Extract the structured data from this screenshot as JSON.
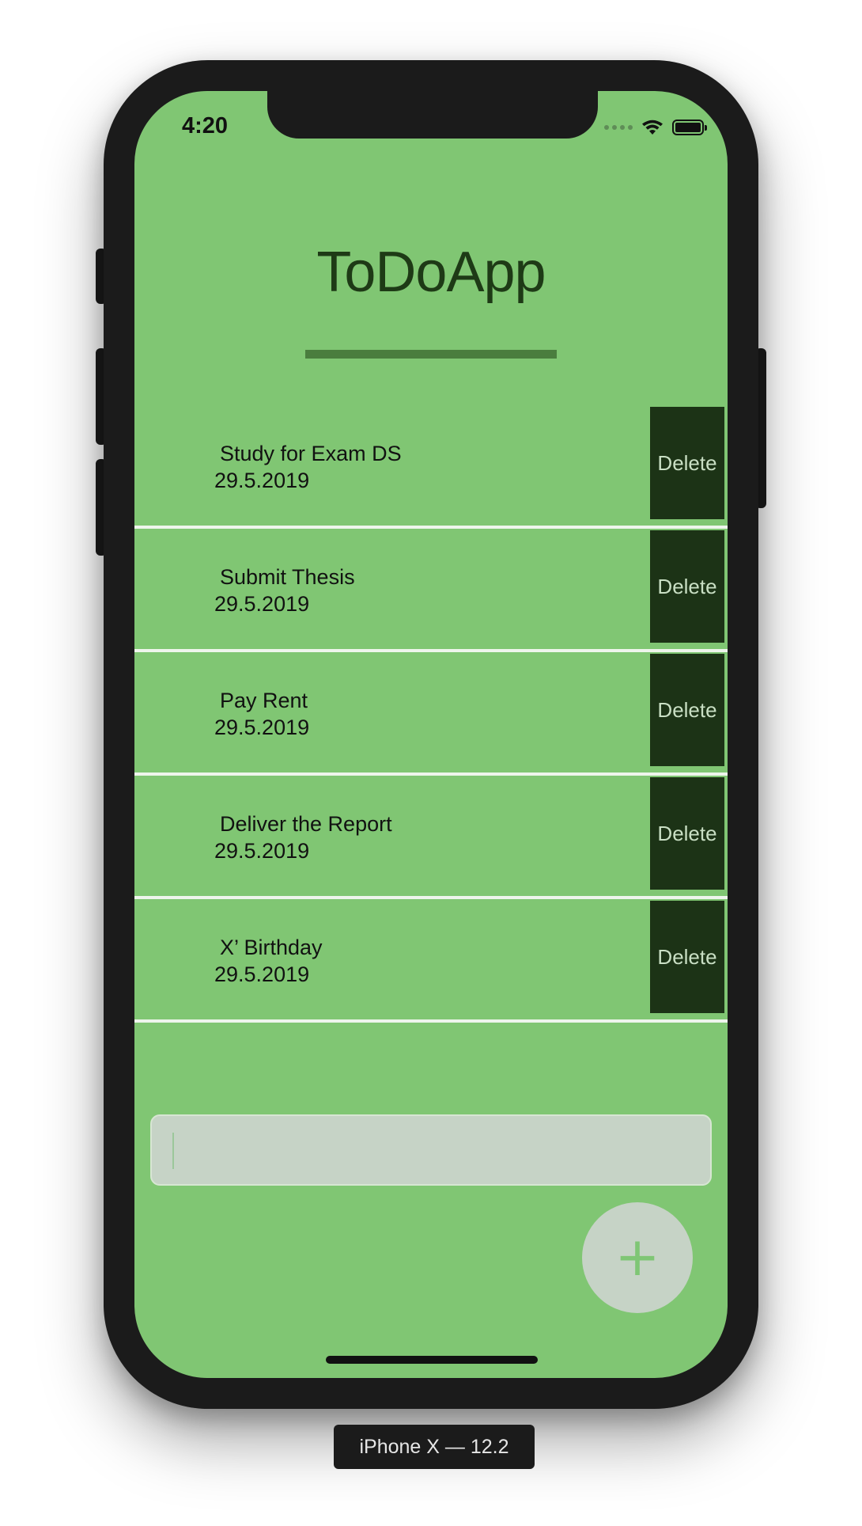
{
  "status_bar": {
    "time": "4:20",
    "icons": [
      "signal-dots-icon",
      "wifi-icon",
      "battery-icon"
    ]
  },
  "app": {
    "title": "ToDoApp"
  },
  "todos": [
    {
      "title": "Study for Exam DS",
      "date": "29.5.2019",
      "delete_label": "Delete"
    },
    {
      "title": "Submit Thesis",
      "date": "29.5.2019",
      "delete_label": "Delete"
    },
    {
      "title": "Pay Rent",
      "date": "29.5.2019",
      "delete_label": "Delete"
    },
    {
      "title": "Deliver the Report",
      "date": "29.5.2019",
      "delete_label": "Delete"
    },
    {
      "title": "X’ Birthday",
      "date": "29.5.2019",
      "delete_label": "Delete"
    }
  ],
  "input": {
    "value": "",
    "placeholder": ""
  },
  "add_button": {
    "label": "+"
  },
  "device": {
    "label": "iPhone X — 12.2"
  },
  "colors": {
    "background": "#80c673",
    "title": "#1e3a16",
    "delete_button": "#1c3316",
    "input_background": "#c6d3c6"
  }
}
